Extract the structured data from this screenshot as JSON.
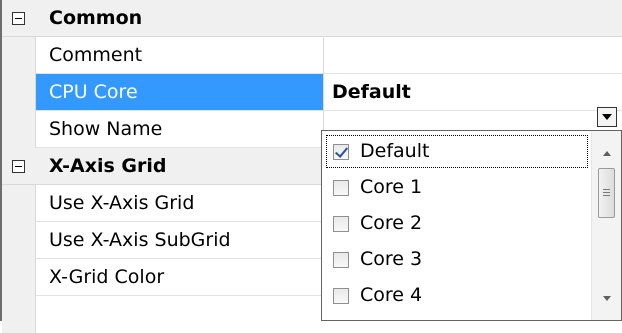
{
  "property_grid": {
    "categories": [
      {
        "label": "Common"
      },
      {
        "label": "X-Axis Grid"
      }
    ],
    "common_rows": [
      {
        "name": "Comment",
        "value": ""
      },
      {
        "name": "CPU Core",
        "value": "Default"
      },
      {
        "name": "Show Name",
        "value": ""
      }
    ],
    "xgrid_rows": [
      {
        "name": "Use X-Axis Grid"
      },
      {
        "name": "Use X-Axis SubGrid"
      },
      {
        "name": "X-Grid Color"
      }
    ]
  },
  "dropdown": {
    "items": [
      {
        "label": "Default",
        "checked": true
      },
      {
        "label": "Core 1",
        "checked": false
      },
      {
        "label": "Core 2",
        "checked": false
      },
      {
        "label": "Core 3",
        "checked": false
      },
      {
        "label": "Core 4",
        "checked": false
      }
    ]
  },
  "icons": {
    "expander": "collapse-minus-icon",
    "dropdown_button": "chevron-down-icon",
    "scroll_up": "scroll-up-arrow-icon",
    "scroll_down": "scroll-down-arrow-icon"
  },
  "colors": {
    "selection": "#3399ff",
    "category_background": "#f0f0f0"
  }
}
